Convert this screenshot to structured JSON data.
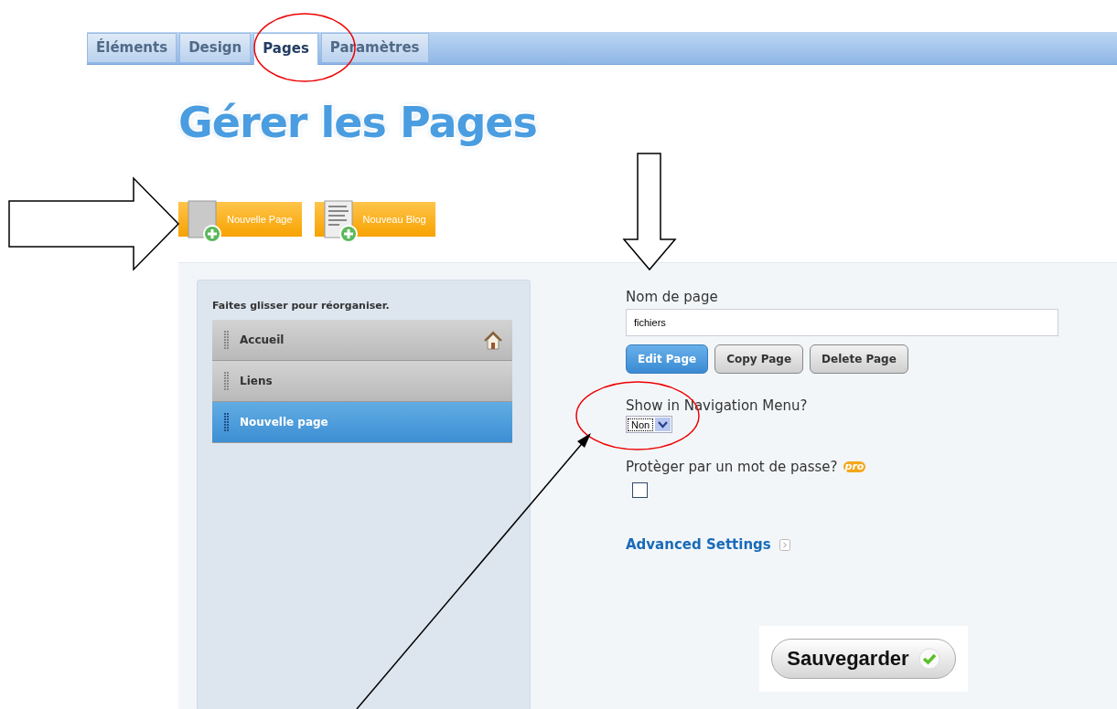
{
  "tabs": [
    {
      "label": "Éléments",
      "selected": false
    },
    {
      "label": "Design",
      "selected": false
    },
    {
      "label": "Pages",
      "selected": true
    },
    {
      "label": "Paramètres",
      "selected": false
    }
  ],
  "title": "Gérer les Pages",
  "create_buttons": [
    {
      "label": "Nouvelle Page",
      "kind": "page"
    },
    {
      "label": "Nouveau Blog",
      "kind": "blog"
    }
  ],
  "sidebar": {
    "hint": "Faites glisser pour réorganiser.",
    "items": [
      {
        "label": "Accueil",
        "selected": false,
        "home": true
      },
      {
        "label": "Liens",
        "selected": false,
        "home": false
      },
      {
        "label": "Nouvelle page",
        "selected": true,
        "home": false
      }
    ]
  },
  "form": {
    "name_label": "Nom de page",
    "name_value": "fichiers",
    "actions": [
      {
        "label": "Edit Page",
        "selected": true
      },
      {
        "label": "Copy Page",
        "selected": false
      },
      {
        "label": "Delete Page",
        "selected": false
      }
    ],
    "nav_label": "Show in Navigation Menu?",
    "nav_value": "Non",
    "password_label": "Protèger par un mot de passe?",
    "pro_badge": "pro",
    "password_checked": false,
    "advanced_link": "Advanced Settings",
    "save_button": "Sauvegarder"
  }
}
